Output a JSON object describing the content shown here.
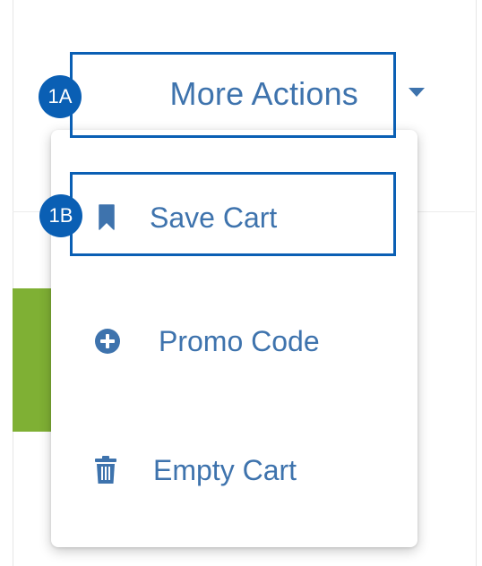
{
  "header": {
    "more_actions_label": "More Actions"
  },
  "dropdown": {
    "items": [
      {
        "label": "Save Cart",
        "icon": "bookmark-icon"
      },
      {
        "label": "Promo Code",
        "icon": "plus-circle-icon"
      },
      {
        "label": "Empty Cart",
        "icon": "trash-icon"
      }
    ]
  },
  "annotations": {
    "badge_1a": "1A",
    "badge_1b": "1B"
  },
  "colors": {
    "link_blue": "#3e73ad",
    "annotation_blue": "#0a5fb4",
    "green_strip": "#7fb034"
  }
}
